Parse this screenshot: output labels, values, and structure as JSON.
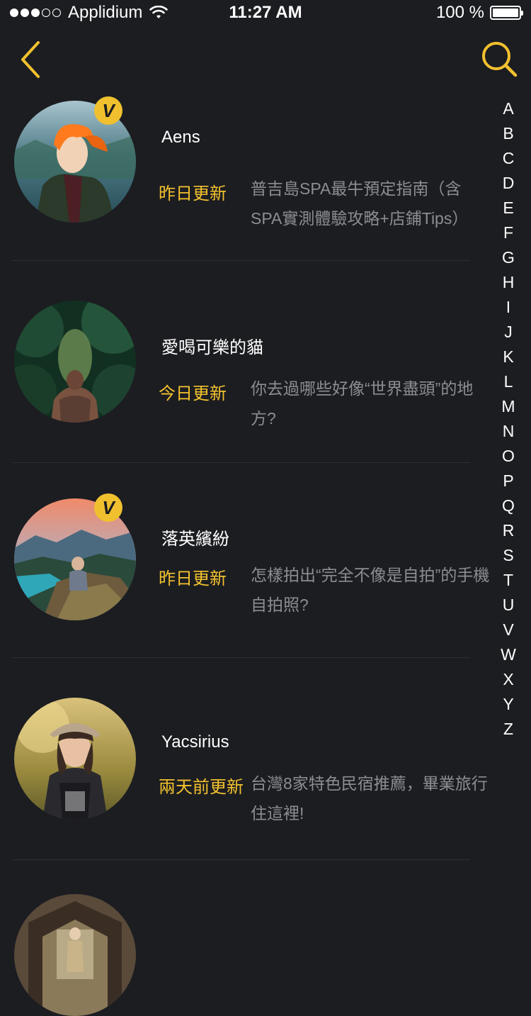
{
  "status_bar": {
    "carrier": "Applidium",
    "time": "11:27 AM",
    "battery": "100 %"
  },
  "nav": {
    "back_icon": "chevron-left-icon",
    "search_icon": "search-icon",
    "accent": "#f2c12e"
  },
  "contacts": [
    {
      "name": "Aens",
      "update": "昨日更新",
      "desc": "普吉島SPA最牛預定指南（含SPA實測體驗攻略+店鋪Tips）",
      "verified": true
    },
    {
      "name": "愛喝可樂的貓",
      "update": "今日更新",
      "desc": "你去過哪些好像“世界盡頭”的地方?",
      "verified": false
    },
    {
      "name": "落英繽紛",
      "update": "昨日更新",
      "desc": "怎樣拍出“完全不像是自拍”的手機自拍照?",
      "verified": true
    },
    {
      "name": "Yacsirius",
      "update": "兩天前更新",
      "desc": "台灣8家特色民宿推薦，畢業旅行住這裡!",
      "verified": false
    }
  ],
  "alphabet": [
    "A",
    "B",
    "C",
    "D",
    "E",
    "F",
    "G",
    "H",
    "I",
    "J",
    "K",
    "L",
    "M",
    "N",
    "O",
    "P",
    "Q",
    "R",
    "S",
    "T",
    "U",
    "V",
    "W",
    "X",
    "Y",
    "Z"
  ],
  "colors": {
    "background": "#1c1d21",
    "accent": "#f2c12e",
    "secondary_text": "#8c8d91",
    "divider": "#2e2f34"
  }
}
